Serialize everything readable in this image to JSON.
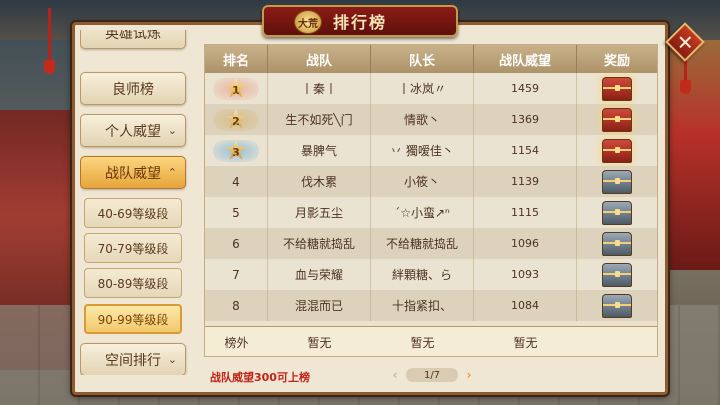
{
  "title": "排行榜",
  "title_emblem": "大荒",
  "close_label": "✕",
  "sidebar": {
    "items": [
      {
        "label": "英雄试炼",
        "expandable": false
      },
      {
        "label": "良师榜",
        "expandable": false
      },
      {
        "label": "个人威望",
        "expandable": true,
        "chevron": "⌄"
      },
      {
        "label": "战队威望",
        "expandable": true,
        "chevron": "⌃",
        "active": true
      }
    ],
    "sub_items": [
      {
        "label": "40-69等级段"
      },
      {
        "label": "70-79等级段"
      },
      {
        "label": "80-89等级段"
      },
      {
        "label": "90-99等级段",
        "active": true
      }
    ],
    "bottom_item": {
      "label": "空间排行",
      "chevron": "⌄"
    }
  },
  "table": {
    "headers": [
      "排名",
      "战队",
      "队长",
      "战队威望",
      "奖励"
    ],
    "rows": [
      {
        "rank": "1",
        "team": "丨秦丨",
        "captain": "丨冰岚〃",
        "prestige": "1459",
        "reward": "red-chest",
        "badge": "gold"
      },
      {
        "rank": "2",
        "team": "生不如死╲门",
        "captain": "情歌丶",
        "prestige": "1369",
        "reward": "red-chest",
        "badge": "silver"
      },
      {
        "rank": "3",
        "team": "暴脾气",
        "captain": "丷 獨嗳佳丶",
        "prestige": "1154",
        "reward": "red-chest",
        "badge": "bronze"
      },
      {
        "rank": "4",
        "team": "伐木累",
        "captain": "小筱丶",
        "prestige": "1139",
        "reward": "blue-chest"
      },
      {
        "rank": "5",
        "team": "月影五尘",
        "captain": "ˊ☆小蛮↗ⁿ",
        "prestige": "1115",
        "reward": "blue-chest"
      },
      {
        "rank": "6",
        "team": "不给糖就捣乱",
        "captain": "不给糖就捣乱",
        "prestige": "1096",
        "reward": "blue-chest"
      },
      {
        "rank": "7",
        "team": "血与荣耀",
        "captain": "絆顆糖、ら",
        "prestige": "1093",
        "reward": "blue-chest"
      },
      {
        "rank": "8",
        "team": "混混而已",
        "captain": "十指紧扣、",
        "prestige": "1084",
        "reward": "blue-chest"
      }
    ],
    "footer": {
      "rank": "榜外",
      "team": "暂无",
      "captain": "暂无",
      "prestige": "暂无"
    }
  },
  "hint": "战队威望300可上榜",
  "pager": {
    "prev": "‹",
    "next": "›",
    "page_label": "1/7",
    "current": 1,
    "total": 7
  },
  "colors": {
    "accent": "#e7a53a",
    "hint": "#c12418",
    "frame": "#8d5b32"
  }
}
